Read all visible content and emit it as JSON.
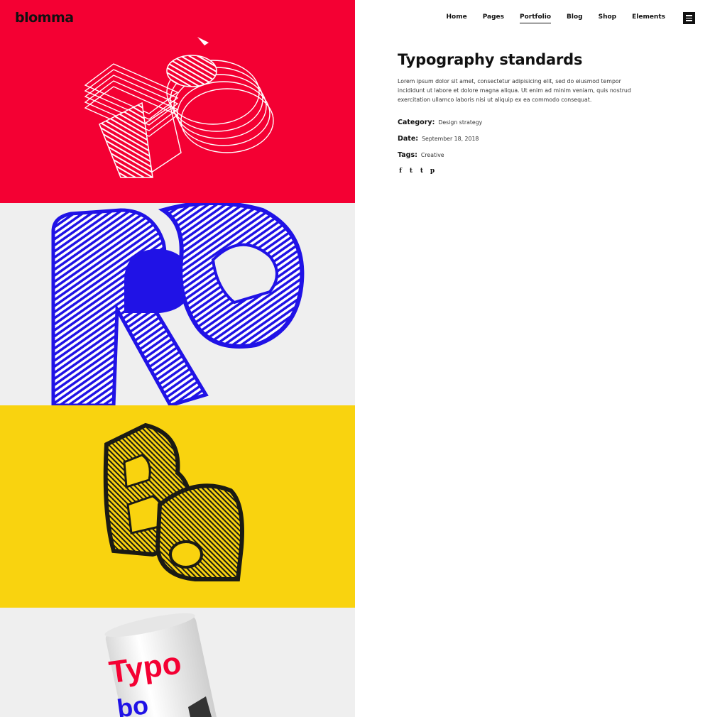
{
  "brand": {
    "logo": "blomma"
  },
  "nav": {
    "items": [
      {
        "label": "Home"
      },
      {
        "label": "Pages"
      },
      {
        "label": "Portfolio",
        "active": true
      },
      {
        "label": "Blog"
      },
      {
        "label": "Shop"
      },
      {
        "label": "Elements"
      }
    ],
    "menu_icon": "hamburger-icon"
  },
  "project": {
    "title": "Typography standards",
    "description": "Lorem ipsum dolor sit amet, consectetur adipisicing elit, sed do eiusmod tempor incididunt ut labore et dolore magna aliqua. Ut enim ad minim veniam, quis nostrud exercitation ullamco laboris nisi ut aliquip ex ea commodo consequat.",
    "meta": [
      {
        "label": "Category:",
        "value": "Design strategy"
      },
      {
        "label": "Date:",
        "value": "September 18, 2018"
      },
      {
        "label": "Tags:",
        "value": "Creative"
      }
    ],
    "social": [
      {
        "icon": "facebook-icon",
        "glyph": "f"
      },
      {
        "icon": "twitter-icon",
        "glyph": "t"
      },
      {
        "icon": "tumblr-icon",
        "glyph": "t"
      },
      {
        "icon": "pinterest-icon",
        "glyph": "p"
      }
    ]
  },
  "gallery": {
    "panels": [
      {
        "name": "gallery-image-red",
        "bg": "#f40033",
        "letters": "Aé"
      },
      {
        "name": "gallery-image-blue",
        "bg": "#efefef",
        "letters": "Re"
      },
      {
        "name": "gallery-image-yellow",
        "bg": "#f9d30f",
        "letters": "Ba"
      },
      {
        "name": "gallery-image-can",
        "bg": "#efefef",
        "letters": "Typo"
      }
    ]
  },
  "colors": {
    "red": "#f40033",
    "blue": "#2012e6",
    "yellow": "#f9d30f",
    "ink": "#111111"
  }
}
